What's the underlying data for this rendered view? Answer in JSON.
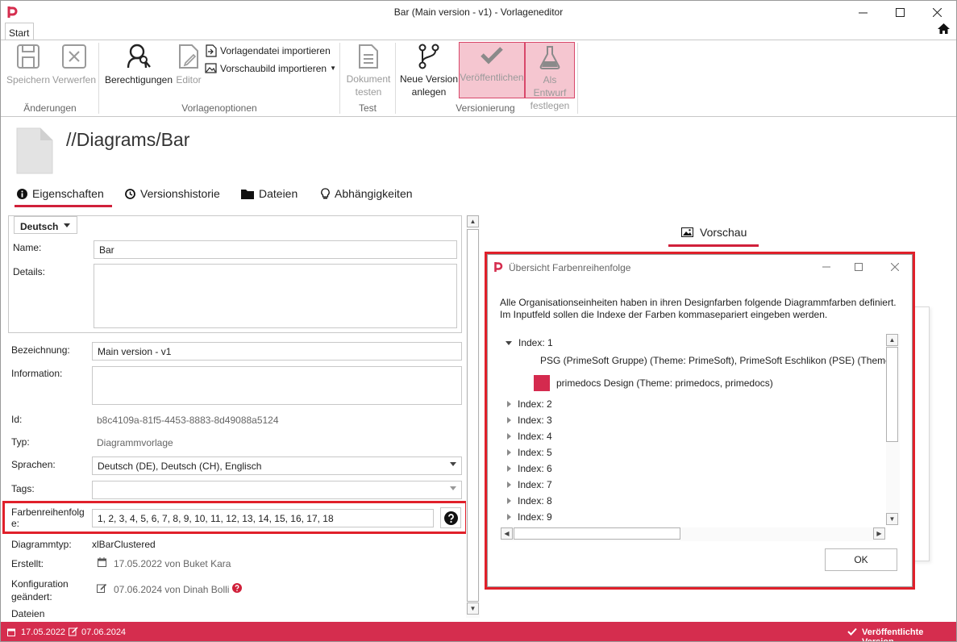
{
  "window": {
    "title": "Bar (Main version - v1) - Vorlageneditor"
  },
  "ribbon": {
    "tab": "Start",
    "buttons": {
      "save": "Speichern",
      "discard": "Verwerfen",
      "permissions": "Berechtigungen",
      "editor": "Editor",
      "import_template": "Vorlagendatei importieren",
      "import_preview": "Vorschaubild importieren",
      "test_document_1": "Dokument",
      "test_document_2": "testen",
      "new_version_1": "Neue Version",
      "new_version_2": "anlegen",
      "publish": "Veröffentlichen",
      "draft_1": "Als Entwurf",
      "draft_2": "festlegen"
    },
    "groups": {
      "changes": "Änderungen",
      "template_options": "Vorlagenoptionen",
      "test": "Test",
      "versioning": "Versionierung"
    }
  },
  "page": {
    "title": "//Diagrams/Bar"
  },
  "tabs": [
    "Eigenschaften",
    "Versionshistorie",
    "Dateien",
    "Abhängigkeiten"
  ],
  "form": {
    "language": "Deutsch",
    "name_label": "Name:",
    "name_value": "Bar",
    "details_label": "Details:",
    "designation_label": "Bezeichnung:",
    "designation_value": "Main version - v1",
    "information_label": "Information:",
    "id_label": "Id:",
    "id_value": "b8c4109a-81f5-4453-8883-8d49088a5124",
    "type_label": "Typ:",
    "type_value": "Diagrammvorlage",
    "languages_label": "Sprachen:",
    "languages_value": "Deutsch (DE), Deutsch (CH), Englisch",
    "tags_label": "Tags:",
    "color_order_label_1": "Farbenreihenfolg",
    "color_order_label_2": "e:",
    "color_order_value": "1, 2, 3, 4, 5, 6, 7, 8, 9, 10, 11, 12, 13, 14, 15, 16, 17, 18",
    "diagram_type_label": "Diagrammtyp:",
    "diagram_type_value": "xlBarClustered",
    "created_label": "Erstellt:",
    "created_value": "17.05.2022 von Buket Kara",
    "config_label_1": "Konfiguration",
    "config_label_2": "geändert:",
    "config_value": "07.06.2024 von Dinah Bolli",
    "files_label": "Dateien"
  },
  "preview": {
    "title": "Vorschau"
  },
  "dialog": {
    "title": "Übersicht Farbenreihenfolge",
    "text_1": "Alle Organisationseinheiten haben in ihren Designfarben folgende Diagrammfarben definiert.",
    "text_2": "Im Inputfeld sollen die Indexe der Farben kommasepariert eingeben werden.",
    "index_1": "Index: 1",
    "entries": [
      {
        "label": "PSG (PrimeSoft Gruppe) (Theme: PrimeSoft), PrimeSoft Eschlikon (PSE) (Theme",
        "color": "#e8213a"
      },
      {
        "label": "primedocs Design (Theme: primedocs, primedocs)",
        "color": "#d42a4e"
      }
    ],
    "indexes": [
      "Index: 2",
      "Index: 3",
      "Index: 4",
      "Index: 5",
      "Index: 6",
      "Index: 7",
      "Index: 8",
      "Index: 9"
    ],
    "ok": "OK"
  },
  "status": {
    "created": "17.05.2022",
    "changed": "07.06.2024",
    "published": "Veröffentlichte Version"
  },
  "colors": {
    "accent": "#d0203a",
    "highlight": "#e0202a",
    "statusbar": "#d52d4e"
  }
}
